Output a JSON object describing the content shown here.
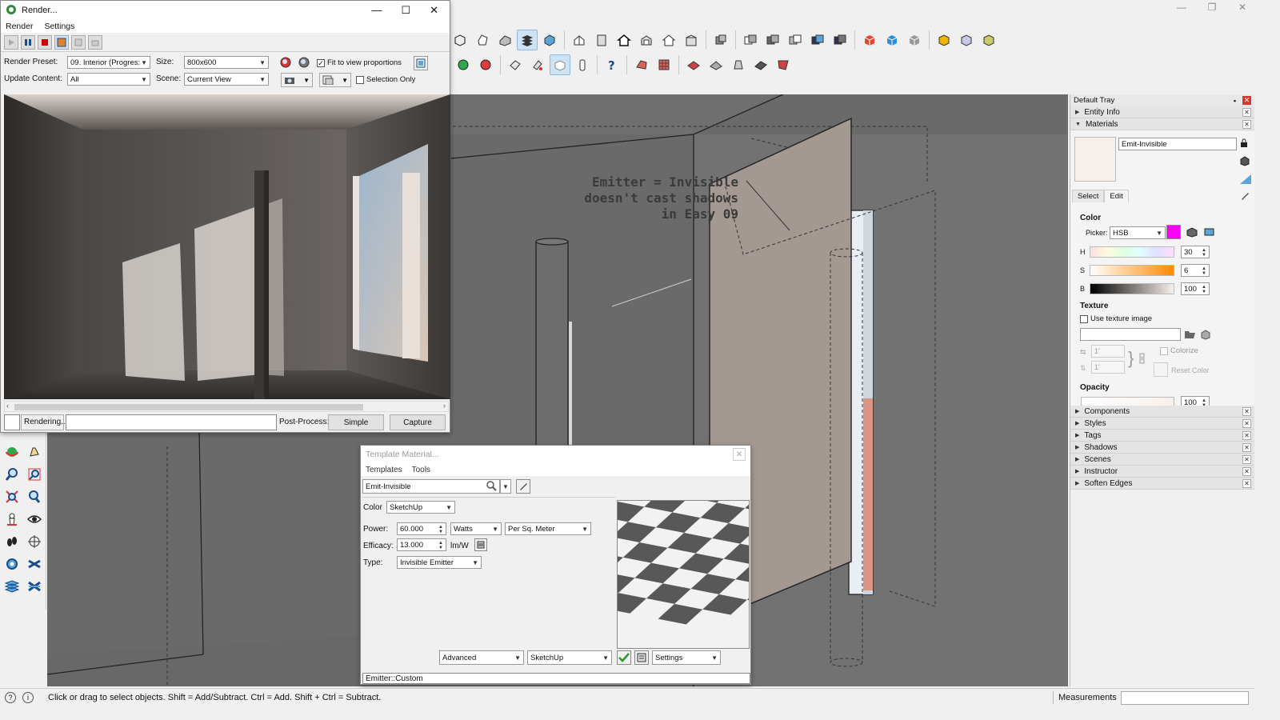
{
  "main_window": {
    "window_controls": [
      "—",
      "❐",
      "✕"
    ]
  },
  "viewport": {
    "annotation_lines": [
      "Emitter = Invisible",
      "doesn't cast shadows",
      "in Easy 09"
    ]
  },
  "render_window": {
    "title": "Render...",
    "menu": [
      "Render",
      "Settings"
    ],
    "render_preset_label": "Render Preset:",
    "render_preset_value": "09. Interior (Progres:",
    "size_label": "Size:",
    "size_value": "800x600",
    "fit_label": "Fit to view proportions",
    "fit_checked": true,
    "update_label": "Update Content:",
    "update_value": "All",
    "scene_label": "Scene:",
    "scene_value": "Current View",
    "selection_only_label": "Selection Only",
    "selection_only_checked": false,
    "status": "Rendering...",
    "post_process_label": "Post-Process:",
    "simple_button": "Simple",
    "capture_button": "Capture"
  },
  "template_material": {
    "title": "Template Material...",
    "menu": [
      "Templates",
      "Tools"
    ],
    "material_name": "Emit-Invisible",
    "color_label": "Color",
    "color_value": "SketchUp",
    "power_label": "Power:",
    "power_value": "60.000",
    "power_unit": "Watts",
    "power_area": "Per Sq. Meter",
    "efficacy_label": "Efficacy:",
    "efficacy_value": "13.000",
    "efficacy_unit": "lm/W",
    "type_label": "Type:",
    "type_value": "Invisible Emitter",
    "advanced_value": "Advanced",
    "sketchup_value": "SketchUp",
    "settings_value": "Settings",
    "status_text": "Emitter::Custom"
  },
  "tray": {
    "title": "Default Tray",
    "panels_top": [
      "Entity Info",
      "Materials"
    ],
    "material_name": "Emit-Invisible",
    "tabs": [
      "Select",
      "Edit"
    ],
    "active_tab": "Edit",
    "color_section": "Color",
    "picker_label": "Picker:",
    "picker_value": "HSB",
    "picker_color": "#ff00ff",
    "h_label": "H",
    "h_value": "30",
    "s_label": "S",
    "s_value": "6",
    "b_label": "B",
    "b_value": "100",
    "texture_section": "Texture",
    "use_texture_label": "Use texture image",
    "dim1": "1'",
    "dim2": "1'",
    "colorize_label": "Colorize",
    "reset_color_label": "Reset Color",
    "opacity_section": "Opacity",
    "opacity_value": "100",
    "panels_bottom": [
      "Components",
      "Styles",
      "Tags",
      "Shadows",
      "Scenes",
      "Instructor",
      "Soften Edges"
    ]
  },
  "statusbar": {
    "hint": "Click or drag to select objects. Shift = Add/Subtract. Ctrl = Add. Shift + Ctrl = Subtract.",
    "measurements_label": "Measurements"
  }
}
